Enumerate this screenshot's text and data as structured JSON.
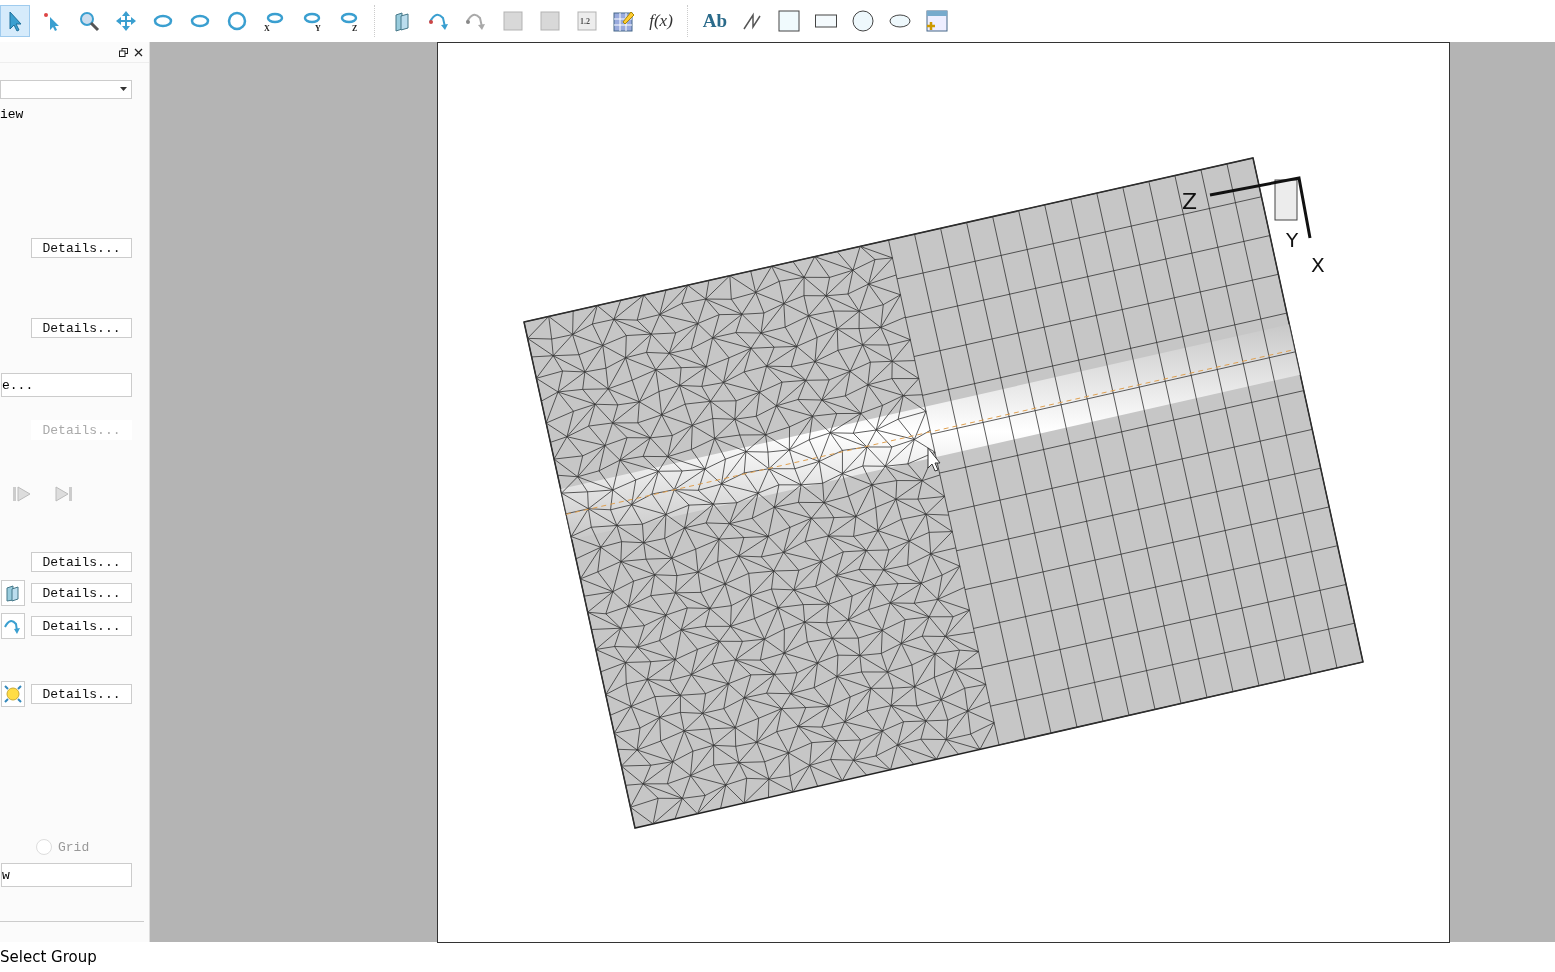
{
  "toolbar": {
    "tools": [
      {
        "kind": "select",
        "selected": true,
        "disabled": false
      },
      {
        "kind": "probe",
        "selected": false,
        "disabled": false
      },
      {
        "kind": "zoom",
        "selected": false,
        "disabled": false
      },
      {
        "kind": "translate",
        "selected": false,
        "disabled": false
      },
      {
        "kind": "rotate",
        "selected": false,
        "disabled": false
      },
      {
        "kind": "spherical",
        "selected": false,
        "disabled": false
      },
      {
        "kind": "roll",
        "selected": false,
        "disabled": false
      },
      {
        "kind": "xrotate",
        "selected": false,
        "disabled": false,
        "label": "X"
      },
      {
        "kind": "yrotate",
        "selected": false,
        "disabled": false,
        "label": "Y"
      },
      {
        "kind": "zrotate",
        "selected": false,
        "disabled": false,
        "label": "Z"
      },
      {
        "kind": "separator"
      },
      {
        "kind": "slice",
        "selected": false,
        "disabled": false
      },
      {
        "kind": "streamtrace",
        "selected": false,
        "disabled": false
      },
      {
        "kind": "streamtrace",
        "selected": false,
        "disabled": true
      },
      {
        "kind": "zoneadd",
        "selected": false,
        "disabled": true
      },
      {
        "kind": "zoneremove",
        "selected": false,
        "disabled": true
      },
      {
        "kind": "labeladd",
        "selected": false,
        "disabled": true,
        "label": "1.2"
      },
      {
        "kind": "gridedit",
        "selected": false,
        "disabled": false
      },
      {
        "kind": "text",
        "selected": false,
        "disabled": false,
        "label": "f(x)"
      },
      {
        "kind": "separator"
      },
      {
        "kind": "bold",
        "selected": false,
        "disabled": false,
        "label": "Ab"
      },
      {
        "kind": "polyline",
        "selected": false,
        "disabled": false
      },
      {
        "kind": "square",
        "selected": false,
        "disabled": false
      },
      {
        "kind": "rectangle",
        "selected": false,
        "disabled": false
      },
      {
        "kind": "circle",
        "selected": false,
        "disabled": false
      },
      {
        "kind": "ellipse",
        "selected": false,
        "disabled": false
      },
      {
        "kind": "frameadd",
        "selected": false,
        "disabled": false
      }
    ]
  },
  "panel": {
    "rows": [
      {
        "kind": "dropdown"
      },
      {
        "kind": "text",
        "text": "iew"
      },
      {
        "kind": "details",
        "label": "Details...",
        "disabled": false
      },
      {
        "kind": "details",
        "label": "Details...",
        "disabled": false
      },
      {
        "kind": "field",
        "value": "e..."
      },
      {
        "kind": "details",
        "label": "Details...",
        "disabled": true
      },
      {
        "kind": "media"
      },
      {
        "kind": "details",
        "label": "Details...",
        "disabled": false
      },
      {
        "kind": "slice_details",
        "label": "Details...",
        "disabled": false
      },
      {
        "kind": "streamtrace_details",
        "label": "Details...",
        "disabled": false
      },
      {
        "kind": "light_details",
        "label": "Details...",
        "disabled": false
      },
      {
        "kind": "radio",
        "label": "Grid",
        "selected": false,
        "disabled": true
      },
      {
        "kind": "field",
        "value": "w"
      }
    ]
  },
  "viewport": {
    "axes": [
      "Z",
      "Y",
      "X"
    ]
  },
  "status_bar": {
    "text": "Select Group"
  }
}
